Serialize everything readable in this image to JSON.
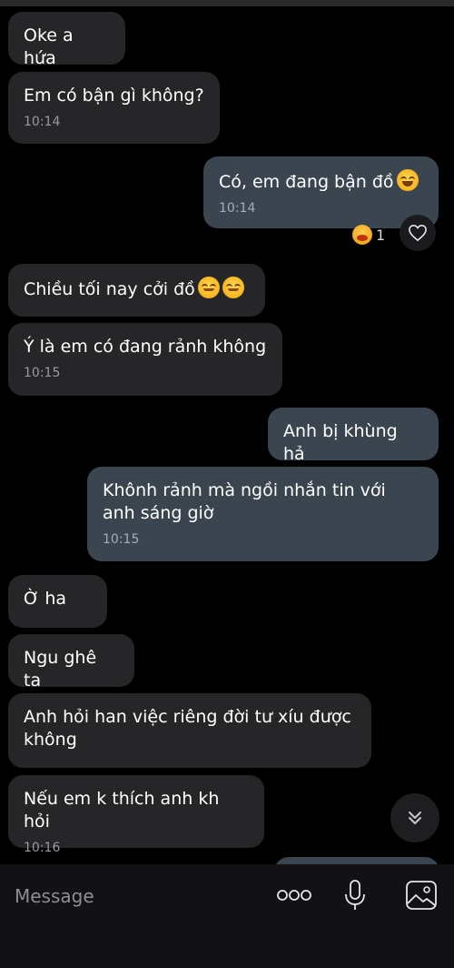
{
  "messages": [
    {
      "dir": "in",
      "text": "Oke a hứa",
      "time": ""
    },
    {
      "dir": "in",
      "text": "Em có bận gì không?",
      "time": "10:14"
    },
    {
      "dir": "out",
      "text": "Có, em đang bận đồ",
      "time": "10:14"
    },
    {
      "dir": "in",
      "text": "Chiều tối nay cởi đồ",
      "time": ""
    },
    {
      "dir": "in",
      "text": "Ý là em có đang rảnh không",
      "time": "10:15"
    },
    {
      "dir": "out",
      "text": "Anh bị khùng hả",
      "time": ""
    },
    {
      "dir": "out",
      "text": "Khônh rảnh mà ngồi nhắn tin với anh sáng giờ",
      "time": "10:15"
    },
    {
      "dir": "in",
      "text": "Ờ ha",
      "time": ""
    },
    {
      "dir": "in",
      "text": "Ngu ghê ta",
      "time": ""
    },
    {
      "dir": "in",
      "text": "Anh hỏi han việc riêng đời tư xíu được không",
      "time": ""
    },
    {
      "dir": "in",
      "text": "Nếu em k thích anh kh hỏi",
      "time": "10:16"
    }
  ],
  "reaction": {
    "icon": "laughing-face-icon",
    "count": "1"
  },
  "composer": {
    "placeholder": "Message",
    "icons": [
      "more-dots-icon",
      "microphone-icon",
      "gallery-icon",
      "heart-icon",
      "scroll-down-icon"
    ]
  },
  "colors": {
    "background": "#000000",
    "incoming_bubble": "#262628",
    "outgoing_bubble": "#3b4550",
    "timestamp": "#9a9aa0"
  }
}
